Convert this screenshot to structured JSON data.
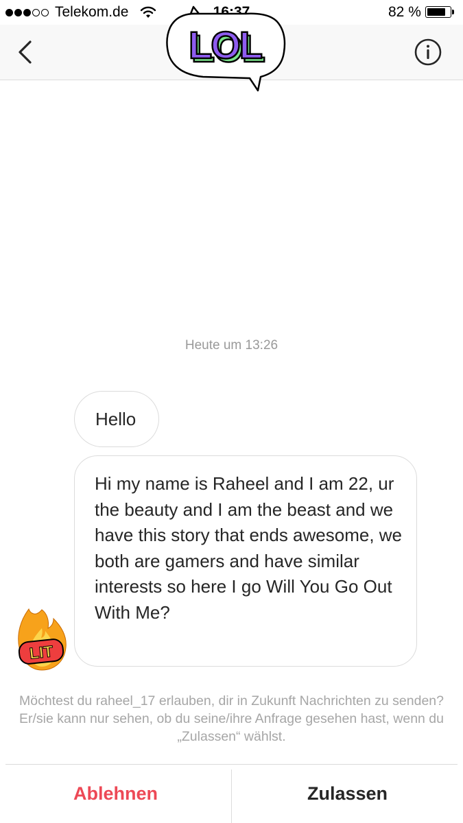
{
  "status_bar": {
    "carrier": "Telekom.de",
    "time": "16:37",
    "battery_percent": "82 %",
    "battery_level": 0.82,
    "signal_bars": 3
  },
  "nav": {
    "back_icon": "chevron-left-icon",
    "info_icon": "info-circle-icon",
    "sticker_text": "LOL"
  },
  "thread": {
    "timestamp": "Heute um 13:26",
    "messages": [
      {
        "text": "Hello"
      },
      {
        "text": "Hi my name is Raheel and I am 22, ur the beauty and I am the beast and we have this story that ends awesome, we both are gamers and have similar interests so here I go Will You Go Out With Me?"
      }
    ],
    "reaction_sticker_text": "LIT"
  },
  "request": {
    "text": "Möchtest du raheel_17 erlauben, dir in Zukunft Nachrichten zu senden? Er/sie kann nur sehen, ob du seine/ihre Anfrage gesehen hast, wenn du „Zulassen“ wählst.",
    "decline_label": "Ablehnen",
    "allow_label": "Zulassen"
  },
  "colors": {
    "decline": "#ed4956",
    "sticker_purple": "#8e5cf0",
    "sticker_green": "#7be38a"
  }
}
